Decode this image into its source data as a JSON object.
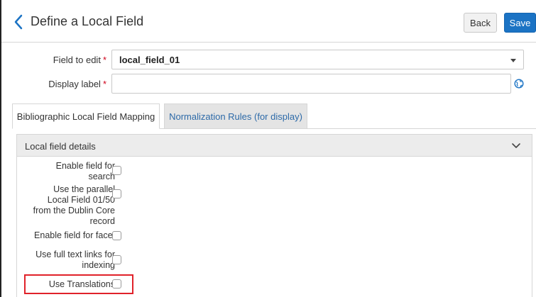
{
  "header": {
    "title": "Define a Local Field",
    "back_button": "Back",
    "save_button": "Save"
  },
  "form": {
    "field_to_edit_label": "Field to edit",
    "field_to_edit_value": "local_field_01",
    "display_label_label": "Display label",
    "display_label_value": "",
    "required_marker": "*"
  },
  "tabs": [
    {
      "label": "Bibliographic Local Field Mapping",
      "active": true
    },
    {
      "label": "Normalization Rules (for display)",
      "active": false
    }
  ],
  "section": {
    "title": "Local field details",
    "options": [
      {
        "label": "Enable field for search",
        "checked": false
      },
      {
        "label": "Use the parallel Local Field 01/50 from the Dublin Core record",
        "checked": false
      },
      {
        "label": "Enable field for facet",
        "checked": false
      },
      {
        "label": "Use full text links for indexing",
        "checked": false
      },
      {
        "label": "Use Translations",
        "checked": false,
        "highlighted": true
      }
    ]
  },
  "colors": {
    "accent": "#1b73c4",
    "link": "#2d6aa8",
    "required": "#d0021b",
    "highlight": "#e0222a"
  }
}
